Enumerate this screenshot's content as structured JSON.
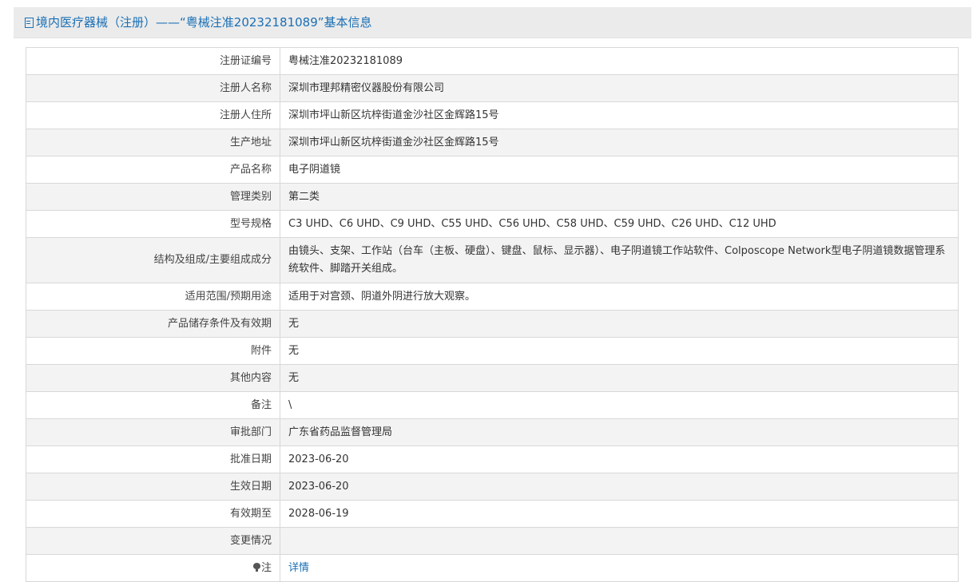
{
  "header": {
    "title": "境内医疗器械（注册）——“粤械注准20232181089”基本信息",
    "icon": "document-icon"
  },
  "rows": [
    {
      "label": "注册证编号",
      "value": "粤械注准20232181089"
    },
    {
      "label": "注册人名称",
      "value": "深圳市理邦精密仪器股份有限公司"
    },
    {
      "label": "注册人住所",
      "value": "深圳市坪山新区坑梓街道金沙社区金辉路15号"
    },
    {
      "label": "生产地址",
      "value": "深圳市坪山新区坑梓街道金沙社区金辉路15号"
    },
    {
      "label": "产品名称",
      "value": "电子阴道镜"
    },
    {
      "label": "管理类别",
      "value": "第二类"
    },
    {
      "label": "型号规格",
      "value": "C3 UHD、C6 UHD、C9 UHD、C55 UHD、C56 UHD、C58 UHD、C59 UHD、C26 UHD、C12 UHD"
    },
    {
      "label": "结构及组成/主要组成成分",
      "value": "由镜头、支架、工作站（台车（主板、硬盘）、键盘、鼠标、显示器）、电子阴道镜工作站软件、Colposcope Network型电子阴道镜数据管理系统软件、脚踏开关组成。"
    },
    {
      "label": "适用范围/预期用途",
      "value": "适用于对宫颈、阴道外阴进行放大观察。"
    },
    {
      "label": "产品储存条件及有效期",
      "value": "无"
    },
    {
      "label": "附件",
      "value": "无"
    },
    {
      "label": "其他内容",
      "value": "无"
    },
    {
      "label": "备注",
      "value": "\\"
    },
    {
      "label": "审批部门",
      "value": "广东省药品监督管理局"
    },
    {
      "label": "批准日期",
      "value": "2023-06-20"
    },
    {
      "label": "生效日期",
      "value": "2023-06-20"
    },
    {
      "label": "有效期至",
      "value": "2028-06-19"
    },
    {
      "label": "变更情况",
      "value": ""
    }
  ],
  "note_row": {
    "label": "注",
    "link_text": "详情",
    "icon": "lightbulb-icon"
  },
  "colors": {
    "link": "#1a6fb5",
    "border": "#d8d8d8",
    "alt_row": "#f3f3f3"
  }
}
